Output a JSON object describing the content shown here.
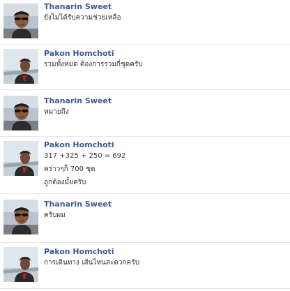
{
  "comments": [
    {
      "author": "Thanarin Sweet",
      "avatar_icon": "profile-photo-man-sunglasses",
      "lines": [
        "ยังไม่ได้รับความช่วยเหลือ"
      ]
    },
    {
      "author": "Pakon Homchoti",
      "avatar_icon": "profile-photo-man-outdoor",
      "lines": [
        "รวมทั้งหมด ต้องการรวมกี่ชุดครับ"
      ]
    },
    {
      "author": "Thanarin Sweet",
      "avatar_icon": "profile-photo-man-sunglasses",
      "lines": [
        "หมายถึง"
      ]
    },
    {
      "author": "Pakon Homchoti",
      "avatar_icon": "profile-photo-man-outdoor",
      "lines": [
        "317 +325 + 250 = 692",
        "คร่าวๆก็ 700 ชุด",
        "ถูกต้องมั้ยครับ"
      ]
    },
    {
      "author": "Thanarin Sweet",
      "avatar_icon": "profile-photo-man-sunglasses",
      "lines": [
        "ครับผม"
      ]
    },
    {
      "author": "Pakon Homchoti",
      "avatar_icon": "profile-photo-man-outdoor",
      "lines": [
        "การเดินทาง เส้นไหนสะดวกครับ"
      ]
    }
  ]
}
